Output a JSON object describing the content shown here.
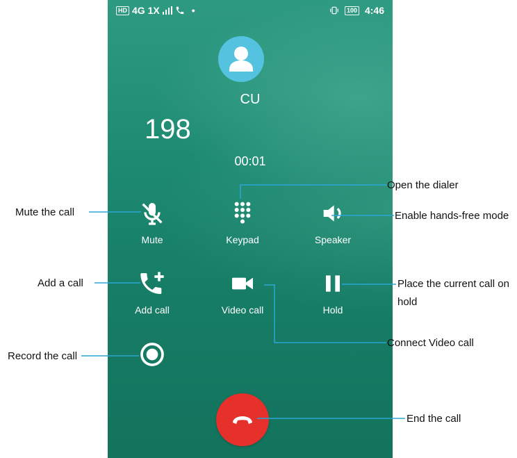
{
  "status_bar": {
    "left": "4G 1X",
    "hd": "HD",
    "battery": "100",
    "time": "4:46"
  },
  "call": {
    "contact_name": "CU",
    "number": "198",
    "timer": "00:01"
  },
  "controls": {
    "mute": "Mute",
    "keypad": "Keypad",
    "speaker": "Speaker",
    "add_call": "Add call",
    "video_call": "Video call",
    "hold": "Hold"
  },
  "annotations": {
    "mute": "Mute the call",
    "keypad": "Open the dialer",
    "speaker": "Enable hands-free mode",
    "add_call": "Add a call",
    "hold_1": "Place the current call on",
    "hold_2": "hold",
    "video": "Connect Video call",
    "record": "Record the call",
    "end": "End the call"
  },
  "colors": {
    "background": "#1e8a72",
    "avatar": "#55c2df",
    "end_call": "#e5302c",
    "leader": "#2aa6d6"
  },
  "icons": [
    "mic-off-icon",
    "keypad-icon",
    "speaker-icon",
    "add-call-icon",
    "video-icon",
    "pause-icon",
    "record-icon",
    "end-call-icon"
  ]
}
